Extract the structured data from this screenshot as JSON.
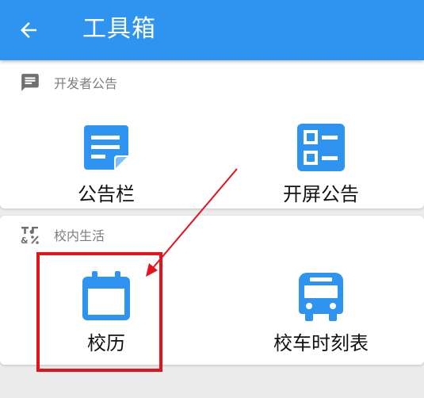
{
  "header": {
    "title": "工具箱",
    "back_icon": "arrow-left-icon"
  },
  "sections": [
    {
      "title": "开发者公告",
      "icon": "message-icon",
      "tools": [
        {
          "label": "公告栏",
          "icon": "note-icon"
        },
        {
          "label": "开屏公告",
          "icon": "dashboard-icon"
        }
      ]
    },
    {
      "title": "校内生活",
      "icon": "symbols-icon",
      "tools": [
        {
          "label": "校历",
          "icon": "calendar-icon"
        },
        {
          "label": "校车时刻表",
          "icon": "bus-icon"
        }
      ]
    }
  ],
  "annotation": {
    "highlight_color": "#e4121b"
  },
  "colors": {
    "primary": "#2f94f0",
    "icon_blue": "#2f94f0"
  }
}
